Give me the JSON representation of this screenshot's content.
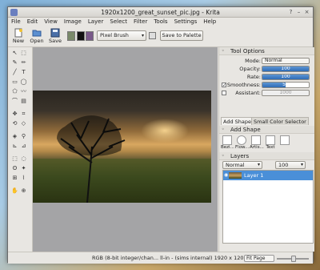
{
  "window": {
    "title": "1920x1200_great_sunset_pic.jpg - Krita",
    "controls": [
      "?",
      "–",
      "×"
    ]
  },
  "menu": [
    "File",
    "Edit",
    "View",
    "Image",
    "Layer",
    "Select",
    "Filter",
    "Tools",
    "Settings",
    "Help"
  ],
  "toolbar": {
    "new_label": "New",
    "open_label": "Open",
    "save_label": "Save",
    "brush_preset": "Pixel Brush",
    "save_palette_label": "Save to Palette"
  },
  "tool_options": {
    "title": "Tool Options",
    "mode_label": "Mode:",
    "mode_value": "Normal",
    "opacity_label": "Opacity:",
    "opacity_value": "100",
    "opacity_fraction": 1.0,
    "rate_label": "Rate:",
    "rate_value": "100",
    "rate_fraction": 1.0,
    "smoothness_label": "Smoothness:",
    "smoothness_value": "50",
    "smoothness_fraction": 0.5,
    "smoothness_checked": true,
    "assistant_label": "Assistant:",
    "assistant_value": "1000",
    "assistant_checked": false
  },
  "tabs": [
    "Add Shape",
    "Small Color Selector"
  ],
  "add_shape": {
    "title": "Add Shape",
    "shapes": [
      "Bezi...",
      "Flow...",
      "Artis...",
      "Text",
      ""
    ]
  },
  "layers": {
    "title": "Layers",
    "blend_mode": "Normal",
    "opacity": "100",
    "items": [
      {
        "name": "Layer 1",
        "selected": true
      }
    ]
  },
  "status": {
    "text": "RGB (8-bit integer/chan... ll-in - (sims internal) 1920 x 1200",
    "zoom": "Fit Page"
  },
  "colors": {
    "accent": "#4a8fd8",
    "fg_swatch": "#7a5a8a",
    "bg_swatch": "#111111"
  }
}
